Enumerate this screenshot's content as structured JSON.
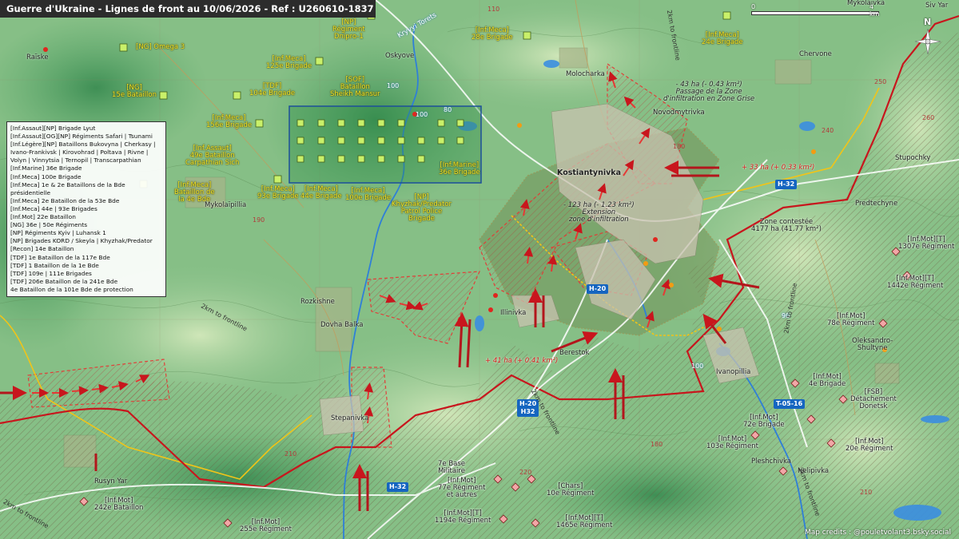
{
  "title": "Guerre d'Ukraine - Lignes de front au 10/06/2026 - Ref : U260610-1837",
  "scale": {
    "start": "0",
    "end": "4 km"
  },
  "compass": {
    "label": "N"
  },
  "credits": "Map credits : @pouletvolant3.bsky.social",
  "colors": {
    "ua_unit": "#f3ea2a",
    "ru_unit": "#f2a7a7",
    "front_line": "#c8161d",
    "infiltration_zone": "#e53935",
    "ua_line": "#f0c419",
    "river": "#2f7fd8",
    "road_badge": "#1565c0"
  },
  "legend": [
    "[Inf.Assaut][NP] Brigade Lyut",
    "[Inf.Assaut][OG][NP] Régiments Safari | Tsunami",
    "[Inf.Légère][NP] Bataillons Bukovyna | Cherkasy |",
    "Ivano-Frankivsk | Kirovohrad | Poltava | Rivne |",
    "Volyn | Vinnytsia | Ternopil | Transcarpathian",
    "[Inf.Marine] 36e Brigade",
    "[Inf.Meca] 100e Brigade",
    "[Inf.Meca] 1e & 2e Bataillons de la Bde",
    "présidentielle",
    "[Inf.Meca] 2e Bataillon de la 53e Bde",
    "[Inf.Meca] 44e | 93e Brigades",
    "[Inf.Mot] 22e Bataillon",
    "[NG] 36e | 50e Régiments",
    "[NP] Régiments Kyiv | Luhansk 1",
    "[NP] Brigades KORD / Skeyla | Khyzhak/Predator",
    "[Recon] 14e Bataillon",
    "[TDF] 1e Bataillon de la 117e Bde",
    "[TDF] 1 Bataillon de la 1e Bde",
    "[TDF] 109e | 111e Brigades",
    "[TDF] 206e Bataillon de la 241e Bde",
    "4e Bataillon de la 101e Bde de protection"
  ],
  "ua_units": [
    {
      "text": "[NP]\nRégiment\nDnipro-1"
    },
    {
      "text": "[Inf.Meca]\n28e Brigade"
    },
    {
      "text": "[Inf.Meca]\n24e Brigade"
    },
    {
      "text": "[NG] Omega 3"
    },
    {
      "text": "[Inf.Meca]\n125e Brigade"
    },
    {
      "text": "[NG]\n15e Bataillon"
    },
    {
      "text": "[TDF]\n104e Brigade"
    },
    {
      "text": "[SOF]\nBataillon\nSheikh Mansur"
    },
    {
      "text": "[Inf.Meca]\n156e Brigade"
    },
    {
      "text": "[Inf.Assaut]\n49e Bataillon\nCarpathian Sich"
    },
    {
      "text": "[Inf.Marine]\n36e Brigade"
    },
    {
      "text": "[Inf.Meca]\nBataillon de\nla 4e Bde"
    },
    {
      "text": "[Inf.Meca]\n93e Brigade"
    },
    {
      "text": "[Inf.Meca]\n44e Brigade"
    },
    {
      "text": "[Inf.Meca]\n100e Brigade"
    },
    {
      "text": "[NP]\nKhyzhak/Predator\nPatrol Police\nBrigade"
    }
  ],
  "ru_units": [
    {
      "text": "[Inf.Mot][T]\n1307e Régiment"
    },
    {
      "text": "[Inf.Mot][T]\n1442e Régiment"
    },
    {
      "text": "[Inf.Mot]\n78e Régiment"
    },
    {
      "text": "[Inf.Mot]\n4e Brigade"
    },
    {
      "text": "[FSB]\nDétachement\nDonetsk"
    },
    {
      "text": "[Inf.Mot]\n72e Brigade"
    },
    {
      "text": "[Inf.Mot]\n103e Régiment"
    },
    {
      "text": "[Inf.Mot]\n20e Régiment"
    },
    {
      "text": "7e Base\nMilitaire"
    },
    {
      "text": "[Inf.Mot]\n77e Régiment\net autres"
    },
    {
      "text": "[Chars]\n10e Régiment"
    },
    {
      "text": "[Inf.Mot][T]\n1194e Régiment"
    },
    {
      "text": "[Inf.Mot][T]\n1465e Régiment"
    },
    {
      "text": "[Inf.Mot]\n242e Bataillon"
    },
    {
      "text": "[Inf.Mot]\n255e Régiment"
    }
  ],
  "places": [
    "Raïske",
    "Oskyove",
    "Molocharka",
    "Chervone",
    "Novodmytrivka",
    "Kostiantynivka",
    "Stupochky",
    "Predtechyne",
    "Mykolaïpillia",
    "Rozkishne",
    "Dovha Balka",
    "Illinivka",
    "Berestok",
    "Ivanopillia",
    "Oleksandro-\nShultyne",
    "Stepanivka",
    "Rusyn Yar",
    "Pleshchivka",
    "Nelipivka",
    "Mykolaivka",
    "Siv Yar",
    "Kryvyi Torets"
  ],
  "notes": [
    "- 43 ha (- 0.43 km²)\nPassage de la Zone\nd'infiltration en Zone Grise",
    "- 123 ha (- 1.23 km²)\nExtension\nzone d'infiltration",
    "Zone contestée\n4177 ha (41.77 km²)"
  ],
  "red_notes": [
    "+ 33 ha (+ 0.33 km²)",
    "+ 41 ha (+ 0.41 km²)"
  ],
  "roads": [
    "H-32",
    "H-20",
    "H-20\nH32",
    "H-32",
    "T-05-16"
  ],
  "altitudes": [
    "100",
    "190",
    "240",
    "260",
    "250",
    "100",
    "180",
    "210",
    "220",
    "210",
    "80",
    "90",
    "100",
    "110",
    "180"
  ],
  "distance_labels": [
    "2km to frontline",
    "2km to frontline",
    "2km to frontline",
    "2km to frontline",
    "2km to frontline",
    "2km to frontline"
  ]
}
